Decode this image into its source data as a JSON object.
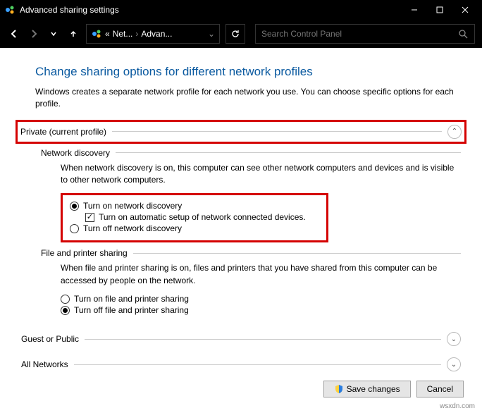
{
  "window": {
    "title": "Advanced sharing settings"
  },
  "nav": {
    "breadcrumb_prefix": "«",
    "breadcrumb1": "Net...",
    "breadcrumb2": "Advan...",
    "search_placeholder": "Search Control Panel"
  },
  "page": {
    "title": "Change sharing options for different network profiles",
    "subtitle": "Windows creates a separate network profile for each network you use. You can choose specific options for each profile."
  },
  "private": {
    "label": "Private (current profile)",
    "network_discovery": {
      "label": "Network discovery",
      "desc": "When network discovery is on, this computer can see other network computers and devices and is visible to other network computers.",
      "opt_on": "Turn on network discovery",
      "opt_auto": "Turn on automatic setup of network connected devices.",
      "opt_off": "Turn off network discovery"
    },
    "file_printer": {
      "label": "File and printer sharing",
      "desc": "When file and printer sharing is on, files and printers that you have shared from this computer can be accessed by people on the network.",
      "opt_on": "Turn on file and printer sharing",
      "opt_off": "Turn off file and printer sharing"
    }
  },
  "guest": {
    "label": "Guest or Public"
  },
  "all": {
    "label": "All Networks"
  },
  "buttons": {
    "save": "Save changes",
    "cancel": "Cancel"
  },
  "watermark": "wsxdn.com"
}
